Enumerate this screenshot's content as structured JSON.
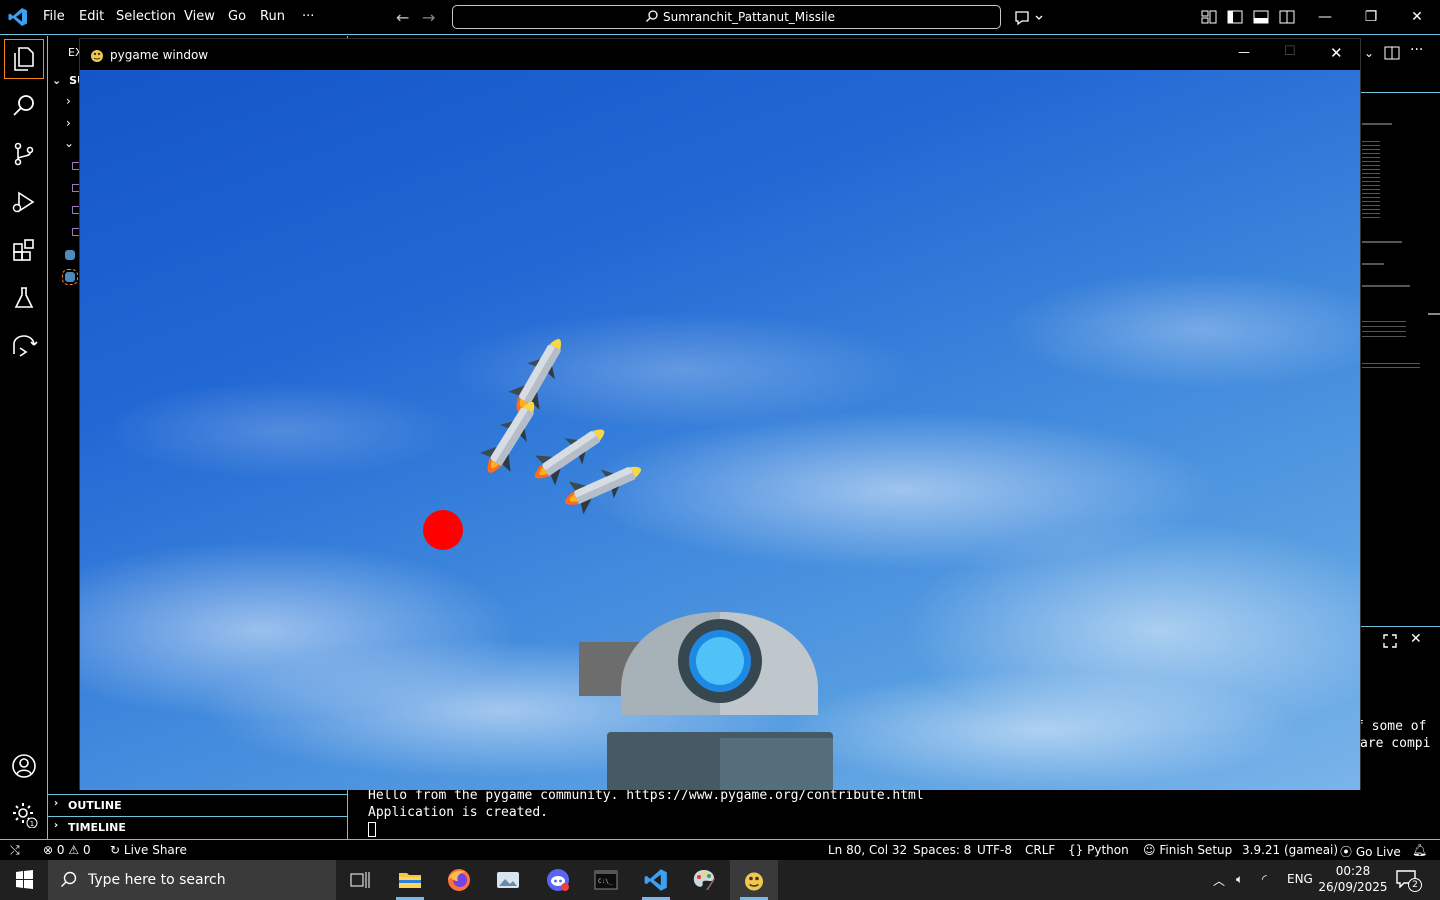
{
  "menu": {
    "file": "File",
    "edit": "Edit",
    "selection": "Selection",
    "view": "View",
    "go": "Go",
    "run": "Run",
    "more": "···"
  },
  "command_center": {
    "text": "Sumranchit_Pattanut_Missile"
  },
  "sidebar": {
    "header": "EX",
    "section_abbrev": "SU",
    "outline": "OUTLINE",
    "timeline": "TIMELINE"
  },
  "pygame": {
    "title": "pygame window",
    "minimize": "—",
    "maximize": "☐",
    "close": "✕"
  },
  "terminal": {
    "line1": "Hello from the pygame community. https://www.pygame.org/contribute.html",
    "line2": "Application is created.",
    "right_line1": "f some of",
    "right_line2": "are compi"
  },
  "statusbar": {
    "errors": "0",
    "warnings": "0",
    "live_share": "Live Share",
    "position": "Ln 80, Col 32",
    "spaces": "Spaces: 8",
    "encoding": "UTF-8",
    "eol": "CRLF",
    "language": "Python",
    "finish_setup": "Finish Setup",
    "interpreter": "3.9.21 (gameai)",
    "go_live": "Go Live"
  },
  "taskbar": {
    "search_placeholder": "Type here to search",
    "language": "ENG",
    "time": "00:28",
    "date": "26/09/2025",
    "notifications": "2",
    "settings_badge": "1"
  },
  "colors": {
    "border_accent": "#6fc3df",
    "focus": "#f38518",
    "ball": "#ff0000",
    "sky_top": "#1455c8",
    "sky_bottom": "#7ab4ea"
  }
}
